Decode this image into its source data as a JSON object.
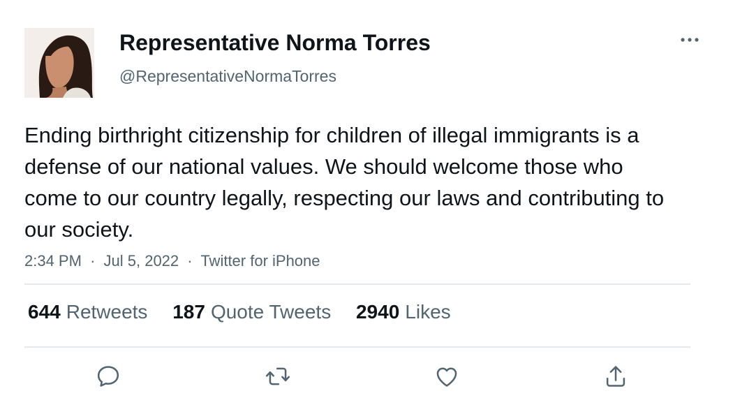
{
  "author": {
    "display_name": "Representative Norma Torres",
    "handle": "@RepresentativeNormaTorres",
    "avatar_icon": "profile-photo"
  },
  "tweet": {
    "text": "Ending birthright citizenship for children of illegal immigrants is a defense of our national values. We should welcome those who come to our country legally, respecting our laws and contributing to our society.",
    "time": "2:34 PM",
    "date": "Jul 5, 2022",
    "separator": "·",
    "source": "Twitter for iPhone"
  },
  "stats": {
    "retweets": {
      "count": "644",
      "label": "Retweets"
    },
    "quote_tweets": {
      "count": "187",
      "label": "Quote Tweets"
    },
    "likes": {
      "count": "2940",
      "label": "Likes"
    }
  },
  "actions": {
    "reply": "reply-icon",
    "retweet": "retweet-icon",
    "like": "heart-icon",
    "share": "share-icon",
    "more": "more-dots-icon"
  },
  "colors": {
    "text_primary": "#0f1419",
    "text_secondary": "#536471",
    "divider": "#e6e9eb",
    "icon": "#536471"
  }
}
